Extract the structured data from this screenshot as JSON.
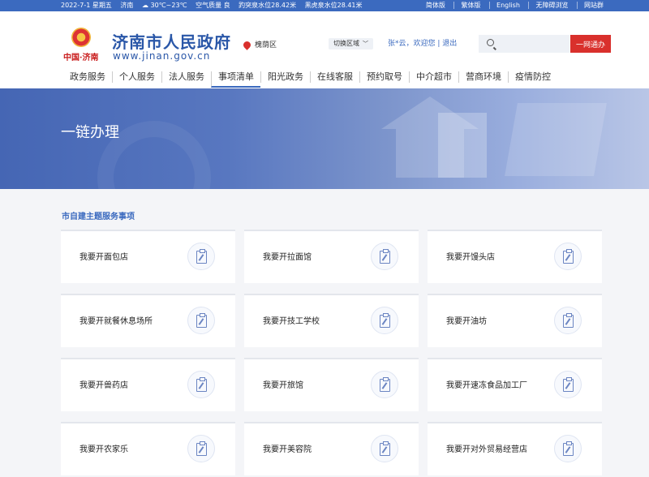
{
  "topbar": {
    "date": "2022-7-1 星期五",
    "city": "济南",
    "weather": "30℃~23℃",
    "air": "空气质量 良",
    "water1": "趵突泉水位28.42米",
    "water2": "黑虎泉水位28.41米",
    "links": [
      "简体版",
      "繁体版",
      "English",
      "无障碍浏览",
      "网站群"
    ]
  },
  "header": {
    "emblem_text": "中国·济南",
    "site_title": "济南市人民政府",
    "site_url": "www.jinan.gov.cn",
    "location": "槐荫区",
    "switch_area": "切换区域",
    "greeting": "张*云，欢迎您 | 退出",
    "search_placeholder": "",
    "search_button": "一网通办"
  },
  "nav": [
    "政务服务",
    "个人服务",
    "法人服务",
    "事项清单",
    "阳光政务",
    "在线客服",
    "预约取号",
    "中介超市",
    "营商环境",
    "疫情防控"
  ],
  "nav_active_index": 3,
  "banner": {
    "title": "一链办理"
  },
  "section": {
    "title": "市自建主题服务事项",
    "cards": [
      "我要开面包店",
      "我要开拉面馆",
      "我要开馒头店",
      "我要开就餐休息场所",
      "我要开技工学校",
      "我要开油坊",
      "我要开兽药店",
      "我要开旅馆",
      "我要开速冻食品加工厂",
      "我要开农家乐",
      "我要开美容院",
      "我要开对外贸易经营店"
    ]
  },
  "colors": {
    "primary": "#3b6abf",
    "accent_red": "#d9302c"
  }
}
